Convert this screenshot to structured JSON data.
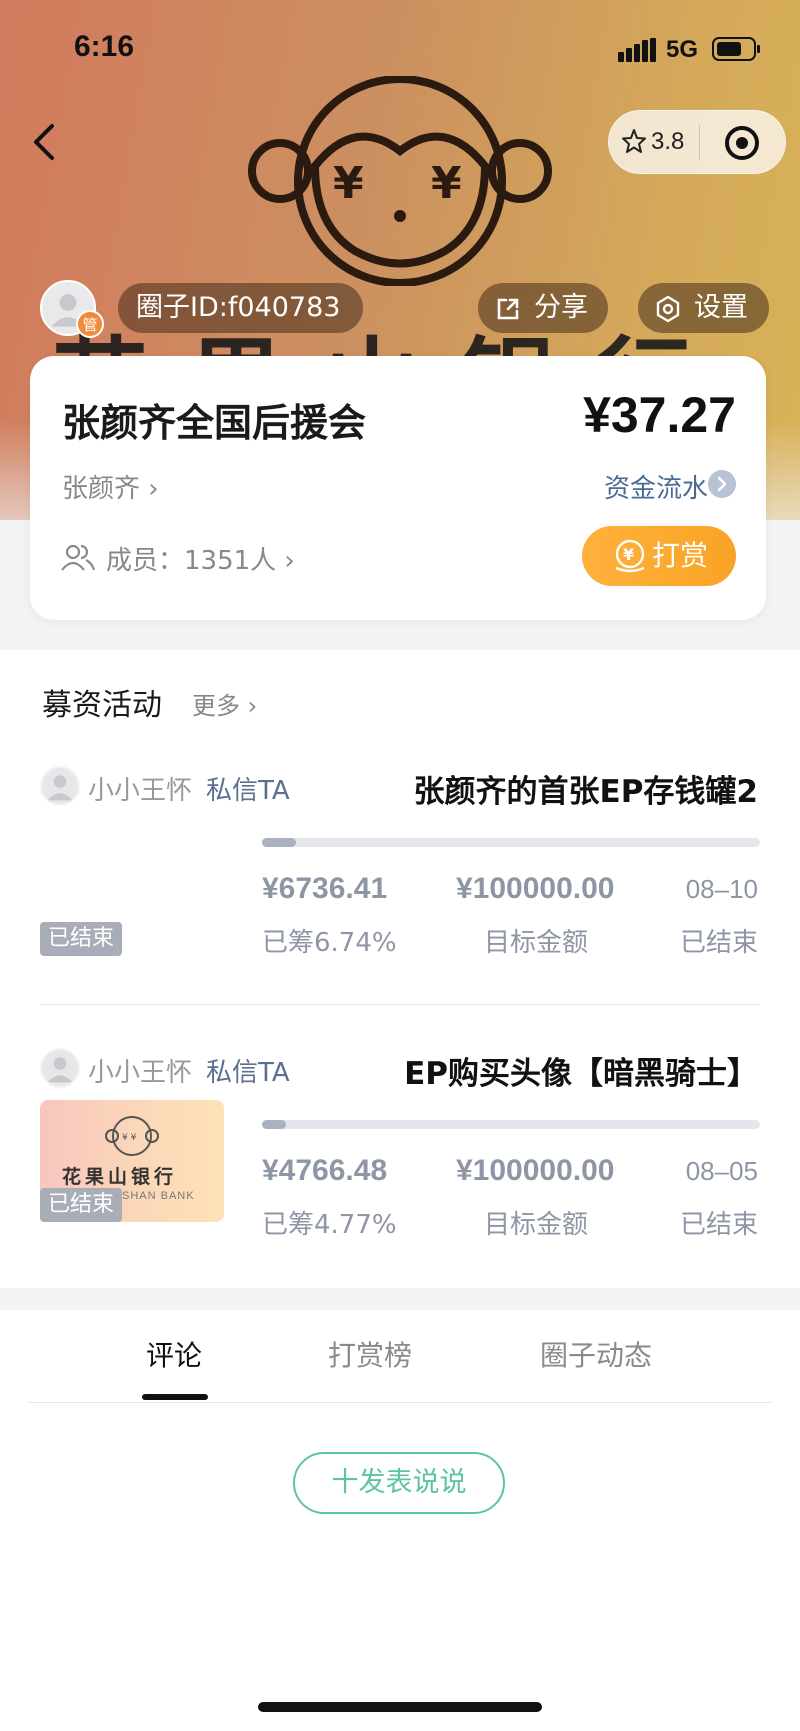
{
  "status_bar": {
    "time": "6:16",
    "network": "5G"
  },
  "header": {
    "rating": "3.8",
    "banner_text": "花果山银行",
    "admin_badge": "管",
    "circle_id_label": "圈子ID:f040783",
    "share_label": "分享",
    "settings_label": "设置"
  },
  "circle": {
    "name": "张颜齐全国后援会",
    "balance": "¥37.27",
    "owner": "张颜齐 ›",
    "flow_label": "资金流水",
    "members": "成员：1351人 ›",
    "reward_label": "打赏"
  },
  "fundraising": {
    "title": "募资活动",
    "more": "更多 ›",
    "items": [
      {
        "user": "小小王怀",
        "message_label": "私信TA",
        "title": "张颜齐的首张EP存钱罐2",
        "raised": "¥6736.41",
        "raised_pct": "已筹6.74%",
        "progress": 0.0674,
        "goal": "¥100000.00",
        "goal_label": "目标金额",
        "date": "08–10",
        "status": "已结束",
        "tag": "已结束"
      },
      {
        "user": "小小王怀",
        "message_label": "私信TA",
        "title": "EP购买头像【暗黑骑士】",
        "raised": "¥4766.48",
        "raised_pct": "已筹4.77%",
        "progress": 0.0477,
        "goal": "¥100000.00",
        "goal_label": "目标金额",
        "date": "08–05",
        "status": "已结束",
        "tag": "已结束",
        "thumb_text": "花果山银行",
        "thumb_sub": "SHAN BANK"
      }
    ]
  },
  "tabs": [
    {
      "label": "评论",
      "active": true
    },
    {
      "label": "打赏榜",
      "active": false
    },
    {
      "label": "圈子动态",
      "active": false
    }
  ],
  "post_button": "十发表说说",
  "colors": {
    "accent_orange": "#f9a325",
    "accent_green": "#5cc4a3",
    "link_blue": "#4a6a96"
  }
}
